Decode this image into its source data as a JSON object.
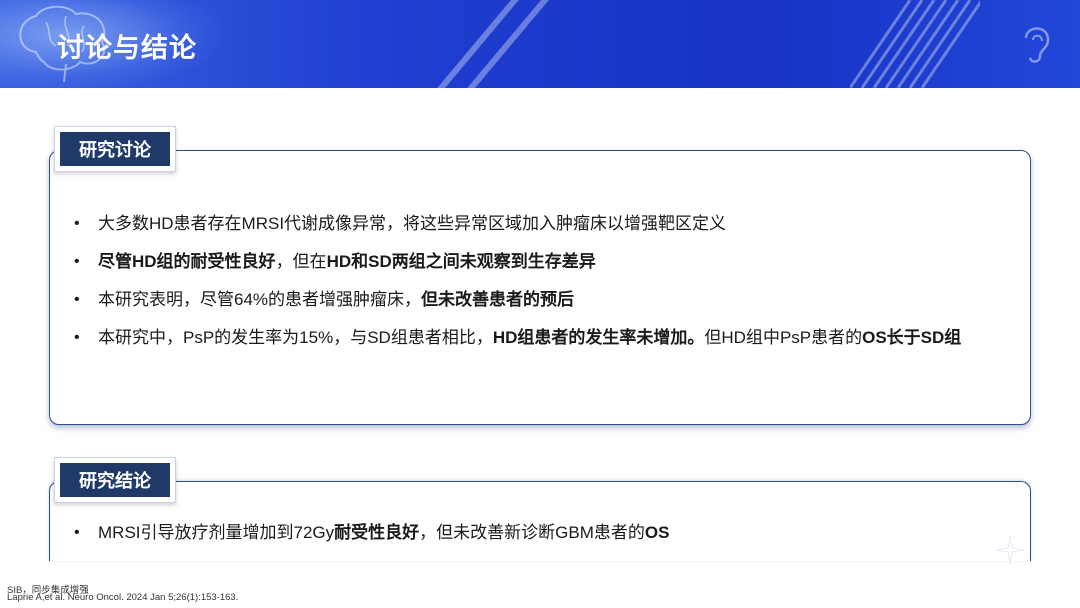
{
  "header": {
    "title": "讨论与结论"
  },
  "discussion": {
    "tag": "研究讨论",
    "items": [
      {
        "parts": [
          {
            "text": "大多数HD患者存在MRSI代谢成像异常，将这些异常区域加入肿瘤床以增强靶区定义",
            "bold": false
          }
        ]
      },
      {
        "parts": [
          {
            "text": "尽管HD组的耐受性良好",
            "bold": true
          },
          {
            "text": "，但在",
            "bold": false
          },
          {
            "text": "HD和SD两组之间未观察到生存差异",
            "bold": true
          }
        ]
      },
      {
        "parts": [
          {
            "text": "本研究表明，尽管64%的患者增强肿瘤床，",
            "bold": false
          },
          {
            "text": "但未改善患者的预后",
            "bold": true
          }
        ]
      },
      {
        "parts": [
          {
            "text": "本研究中，PsP的发生率为15%，与SD组患者相比，",
            "bold": false
          },
          {
            "text": "HD组患者的发生率未增加。",
            "bold": true
          },
          {
            "text": "但HD组中PsP患者的",
            "bold": false
          },
          {
            "text": "OS长于SD组",
            "bold": true
          }
        ]
      }
    ]
  },
  "conclusion": {
    "tag": "研究结论",
    "items": [
      {
        "parts": [
          {
            "text": "MRSI引导放疗剂量增加到72Gy",
            "bold": false
          },
          {
            "text": "耐受性良好",
            "bold": true
          },
          {
            "text": "，但未改善新诊断GBM患者的",
            "bold": false
          },
          {
            "text": "OS",
            "bold": true
          }
        ]
      }
    ]
  },
  "footnotes": {
    "abbrev": "SIB，同步集成增强",
    "reference": "Laprie A,et al. Neuro Oncol. 2024 Jan 5;26(1):153-163."
  },
  "colors": {
    "banner": "#1f3fd0",
    "tag_fill": "#1f3a68",
    "panel_border": "#2c4f8a"
  }
}
